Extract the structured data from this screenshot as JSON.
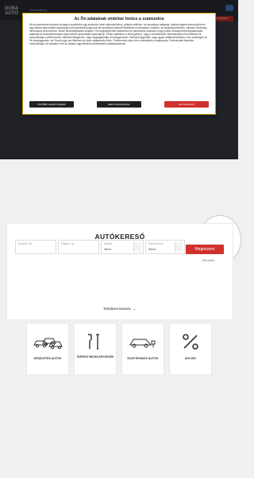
{
  "header": {
    "logo_text": "DUNA\nAUTÓ",
    "brand_text": "Elérhetőség",
    "cta_label": "Szervizbe jelentkezés"
  },
  "cookie": {
    "title": "Az Ön adatainak védelme fontos a számunkra",
    "body": "Mi és partnereink tárolunk és/vagy hozzáférünk egy eszközön tárolt információkhoz, például sütikhez, és személyes adatokat, például egyedi azonosítókat és egy eszköz által küldött szabványos információkat dolgozunk fel személyre szabott hirdetések és tartalmak, hirdetés- és tartalomméréshez, valamint közönség információk szerzéséhez, illetve termékfejlesztés céljából. Ön engedélyezheti számunkra és partnereink számára, hogy pontos földrajzi helymeghatározási adatokat és eszközbeolvasás útján történő azonosítást használjunk. Ehhez kattintson a fenti gombra. Vagy a részletesebb információkhoz hozzáférhet és módosíthatja a preferenciáit, mielőtt beleegyezne, vagy megtagadhatja a beleegyezését. Felhívjuk figyelmét, hogy egyes adatkezelésekhez nem szükséges az Ön beleegyezése, de Önnek joga van tiltakozni az ilyen adatkezelés ellen. Preferenciái csak erre a weboldalra vonatkoznak. Preferenciáit bármikor módosíthatja, ha visszatér erre az oldalra vagy felkeresi adatvédelmi szabályzatunkat.",
    "btn_details": "TOVÁBBI LEHETŐSÉGEK",
    "btn_reject": "NEM FOGADOM EL",
    "btn_accept": "ELFOGADOM"
  },
  "eu_badge": {
    "label": "SZÉCHENYI"
  },
  "search": {
    "title": "AUTÓKERESŐ",
    "fields": [
      {
        "label": "Évjárat -tól",
        "value": ""
      },
      {
        "label": "Évjárat -ig",
        "value": ""
      },
      {
        "label": "Márka",
        "value": "mind"
      },
      {
        "label": "Karosszéria",
        "value": "mind"
      }
    ],
    "button": "Megnézem",
    "subcount": "358 találat",
    "detailed": "Részletes keresés",
    "detailed_caret": "⌄"
  },
  "tiles": [
    {
      "label": "KÉSZLETES AUTÓK",
      "icon": "cars-icon"
    },
    {
      "label": "SZERVIZ BEJELENTKEZÉS",
      "icon": "wrench-screwdriver-icon"
    },
    {
      "label": "ELEKTROMOS AUTÓK",
      "icon": "electric-car-icon"
    },
    {
      "label": "AKCIÓK",
      "icon": "percent-icon"
    }
  ],
  "colors": {
    "accent": "#d0312d",
    "hero_bg": "#3b3f47",
    "page_bg": "#f0f0f1"
  }
}
